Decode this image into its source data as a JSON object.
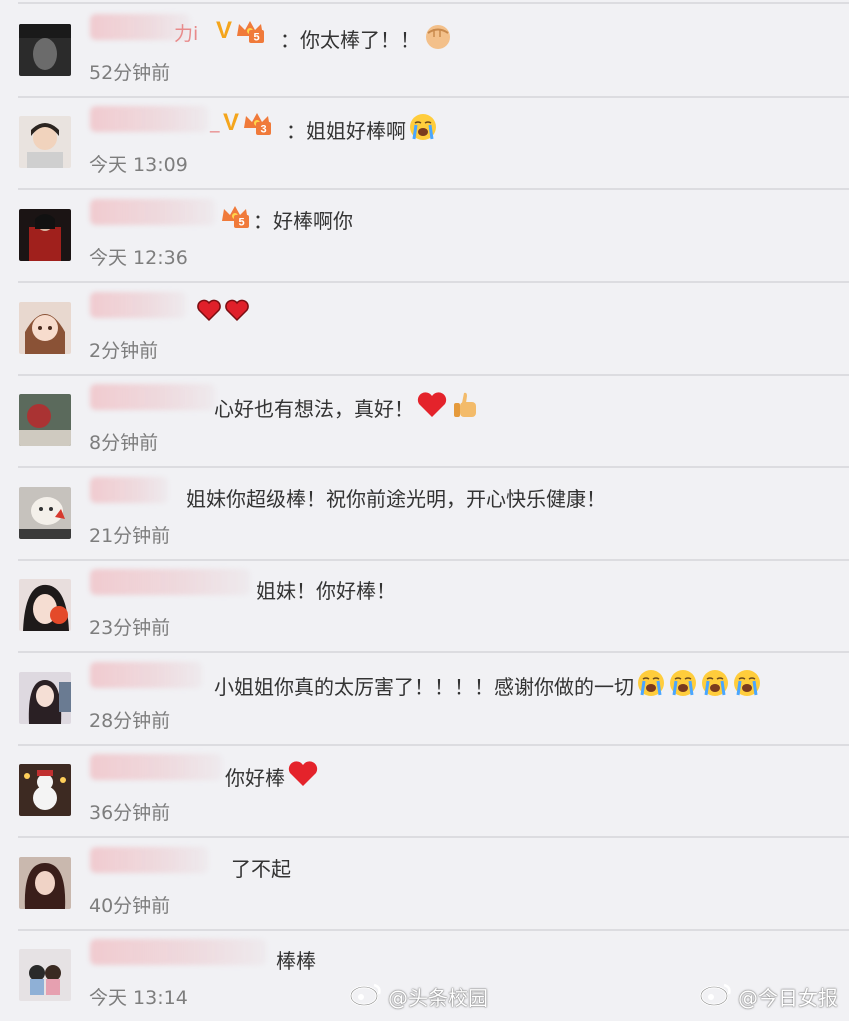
{
  "comments": [
    {
      "name_fragment": "力i",
      "text": "你太棒了！！",
      "time": "52分钟前",
      "level": "5",
      "verified": true
    },
    {
      "name_fragment": "_",
      "text": "姐姐好棒啊",
      "time": "今天 13:09",
      "level": "3",
      "verified": true
    },
    {
      "name_fragment": "",
      "text": "好棒啊你",
      "time": "今天 12:36",
      "level": "5",
      "verified": false
    },
    {
      "name_fragment": "",
      "text": "",
      "time": "2分钟前"
    },
    {
      "name_fragment": "",
      "text": "心好也有想法，真好！",
      "time": "8分钟前"
    },
    {
      "name_fragment": "",
      "text": "姐妹你超级棒！祝你前途光明，开心快乐健康！",
      "time": "21分钟前"
    },
    {
      "name_fragment": "",
      "text": "姐妹！你好棒！",
      "time": "23分钟前"
    },
    {
      "name_fragment": "",
      "text": "小姐姐你真的太厉害了！！！！感谢你做的一切",
      "time": "28分钟前"
    },
    {
      "name_fragment": "",
      "text": "你好棒",
      "time": "36分钟前"
    },
    {
      "name_fragment": "",
      "text": "了不起",
      "time": "40分钟前"
    },
    {
      "name_fragment": "",
      "text": "棒棒",
      "time": "今天 13:14"
    }
  ],
  "verified_mark": "V",
  "separator": "：",
  "watermarks": [
    "@头条校园",
    "@今日女报"
  ],
  "colors": {
    "background": "#f1f1f4",
    "divider": "#dcdce0",
    "time": "#7d7d7d",
    "verified": "#f4a51c",
    "crown": "#f07a3a"
  }
}
